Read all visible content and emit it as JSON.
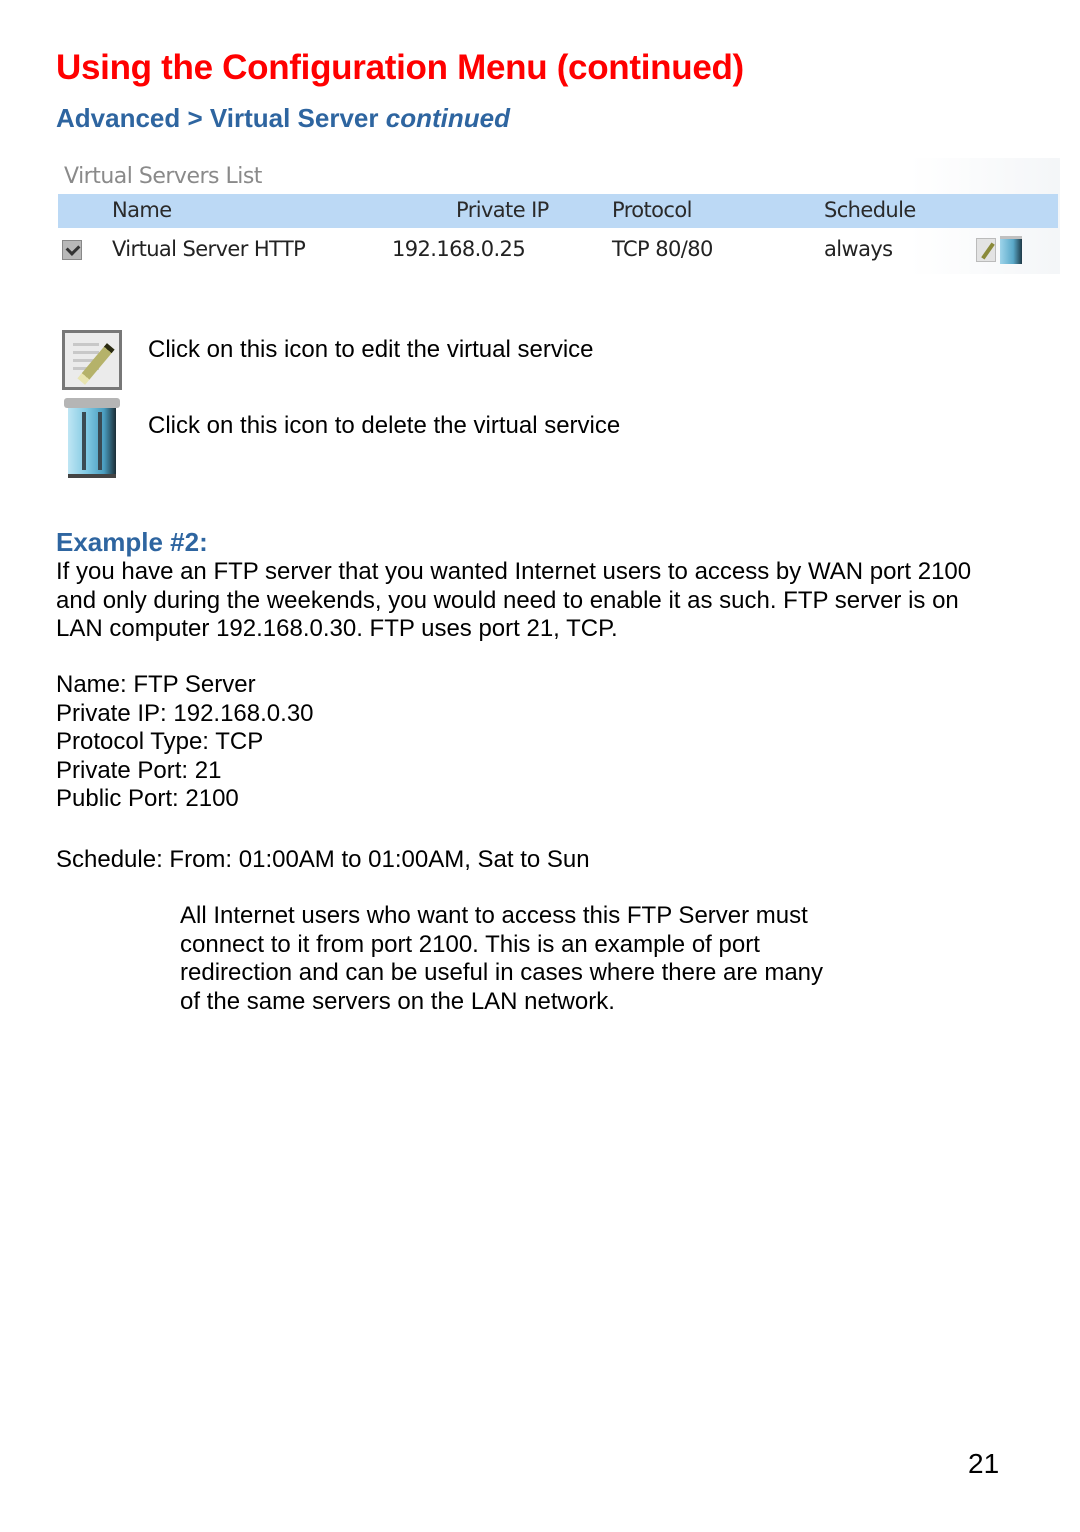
{
  "header": {
    "title": "Using the Configuration Menu (continued)",
    "section_prefix": "Advanced > Virtual Server ",
    "section_suffix": "continued"
  },
  "virtual_servers_list": {
    "title": "Virtual Servers List",
    "columns": [
      "Name",
      "Private IP",
      "Protocol",
      "Schedule"
    ],
    "rows": [
      {
        "checked": true,
        "name": "Virtual Server HTTP",
        "private_ip": "192.168.0.25",
        "protocol": "TCP 80/80",
        "schedule": "always",
        "actions": [
          "edit-icon",
          "trash-icon"
        ]
      }
    ],
    "colors": {
      "header_bg": "#bcd9f5"
    }
  },
  "icon_legend": [
    {
      "icon": "edit-icon",
      "text": "Click on this icon to edit the virtual service"
    },
    {
      "icon": "trash-icon",
      "text": "Click on this icon to delete the virtual service"
    }
  ],
  "example": {
    "title": "Example #2:",
    "paragraph": "If you have an FTP server that you wanted Internet users to access by WAN port 2100 and only during the weekends, you would need to enable it as such. FTP server is on LAN computer 192.168.0.30. FTP uses port 21, TCP.",
    "details": [
      "Name: FTP Server",
      "Private IP: 192.168.0.30",
      "Protocol Type: TCP",
      "Private Port: 21",
      "Public Port: 2100"
    ],
    "schedule": "Schedule: From: 01:00AM to 01:00AM, Sat to Sun",
    "note": "All Internet users who want to access this FTP Server must connect to it from port 2100. This is an example of port redirection and can be useful in cases where there are many of the same servers on the LAN network."
  },
  "page_number": "21",
  "colors": {
    "title": "#ff0000",
    "section": "#2e65a0"
  }
}
